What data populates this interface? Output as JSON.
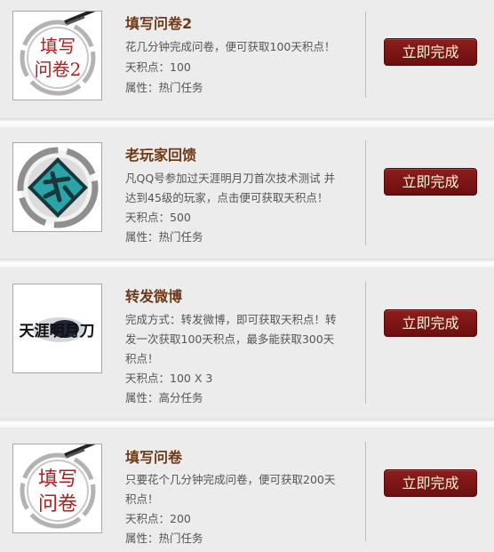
{
  "tasks": [
    {
      "title": "填写问卷2",
      "desc_lines": [
        "花几分钟完成问卷，便可获取100天积点！"
      ],
      "points": "天积点：100",
      "attribute": "属性：热门任务",
      "button": "立即完成",
      "thumb": {
        "icon": "survey-brush-icon",
        "text_lines": [
          "填写",
          "问卷2"
        ]
      }
    },
    {
      "title": "老玩家回馈",
      "desc_lines": [
        "凡QQ号参加过天涯明月刀首次技术测试 并",
        "达到45级的玩家，点击便可获取天积点！"
      ],
      "points": "天积点：500",
      "attribute": "属性：热门任务",
      "button": "立即完成",
      "thumb": {
        "icon": "veteran-game-icon",
        "text_lines": []
      }
    },
    {
      "title": "转发微博",
      "desc_lines": [
        "完成方式：转发微博，即可获取天积点！转",
        "发一次获取100天积点，最多能获取300天",
        "积点！"
      ],
      "points": "天积点：100 X 3",
      "attribute": "属性：高分任务",
      "button": "立即完成",
      "thumb": {
        "icon": "tianya-logo-icon",
        "logo_text": "天涯明月刀"
      }
    },
    {
      "title": "填写问卷",
      "desc_lines": [
        "只要花个几分钟完成问卷，便可获取200天",
        "积点！"
      ],
      "points": "天积点：200",
      "attribute": "属性：热门任务",
      "button": "立即完成",
      "thumb": {
        "icon": "survey-brush-icon",
        "text_lines": [
          "填写",
          "问卷"
        ]
      }
    }
  ],
  "colors": {
    "title": "#6b3a18",
    "button": "#7d1616",
    "thumb_text": "#b31c1c",
    "game_icon": "#2aa4a8"
  }
}
